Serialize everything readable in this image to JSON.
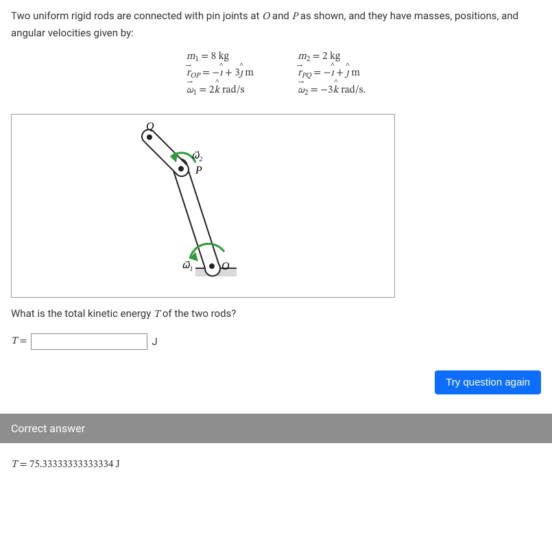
{
  "problem": {
    "intro": "Two uniform rigid rods are connected with pin joints at O and P as shown, and they have masses, positions, and angular velocities given by:"
  },
  "given": {
    "col1": {
      "m": "m₁ = 8 kg",
      "r": "r⃗_OP = −î + 3ĵ m",
      "w": "ω⃗₁ = 2k̂ rad/s"
    },
    "col2": {
      "m": "m₂ = 2 kg",
      "r": "r⃗_PQ = −î + ĵ m",
      "w": "ω⃗₂ = −3k̂ rad/s."
    }
  },
  "figure": {
    "labels": {
      "Q": "Q",
      "P": "P",
      "O": "O",
      "w1": "ω⃗₁",
      "w2": "ω⃗₂"
    }
  },
  "question": "What is the total kinetic energy T of the two rods?",
  "answer": {
    "symbol": "T =",
    "value": "",
    "unit": "J"
  },
  "button": {
    "try_again": "Try question again"
  },
  "correct": {
    "header": "Correct answer",
    "value": "T = 75.33333333333334 J"
  },
  "chart_data": {
    "type": "diagram",
    "description": "Two connected rigid rods OP and PQ with pin joints at O (ground) and P",
    "points": {
      "O": {
        "x": 0,
        "y": 0,
        "note": "fixed ground pin"
      },
      "P": {
        "x": -1,
        "y": 3
      },
      "Q": {
        "x": -2,
        "y": 4
      }
    },
    "rods": [
      {
        "name": "OP",
        "mass_kg": 8,
        "omega_rad_s": 2,
        "axis": "k"
      },
      {
        "name": "PQ",
        "mass_kg": 2,
        "omega_rad_s": -3,
        "axis": "k"
      }
    ]
  }
}
